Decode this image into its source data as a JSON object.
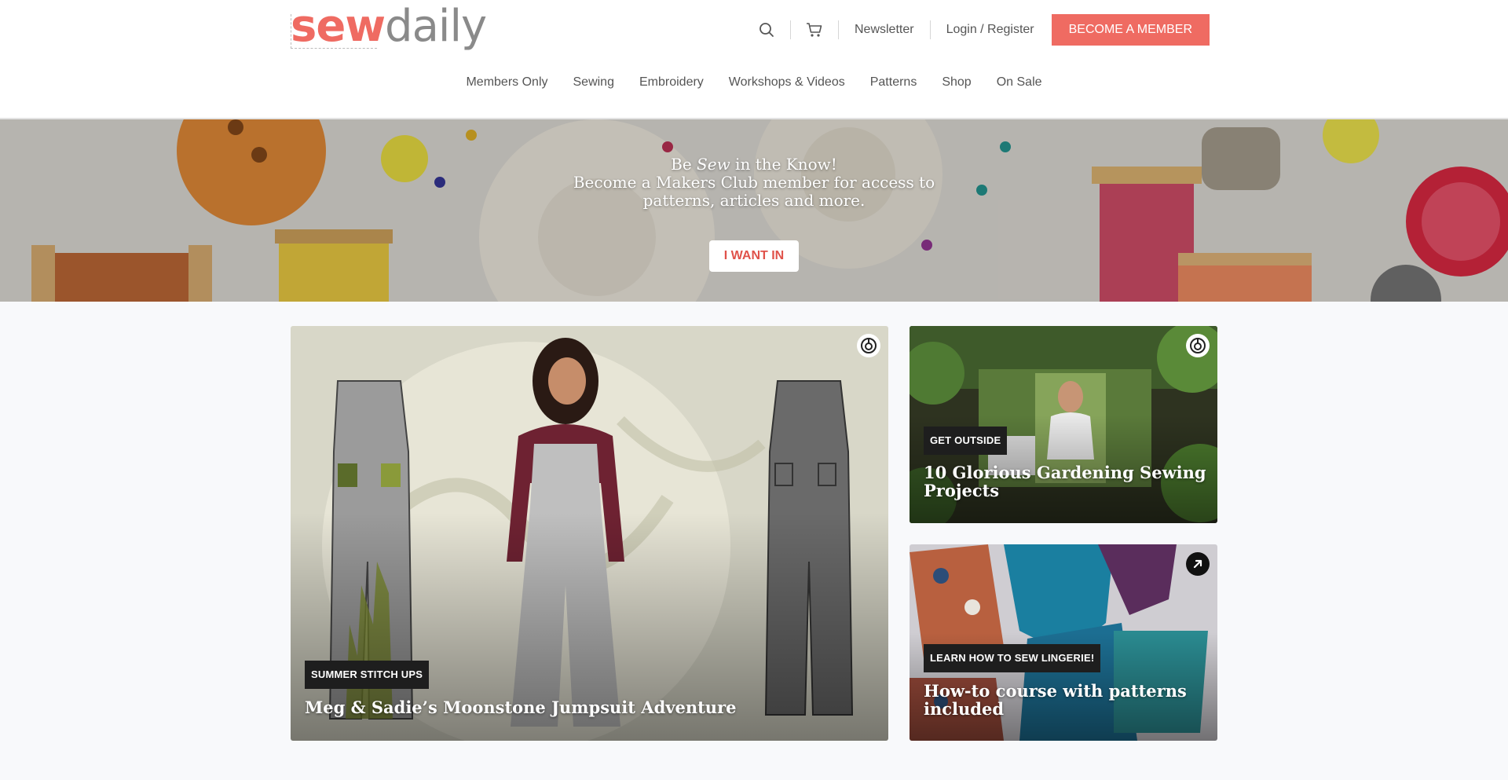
{
  "brand": {
    "logo_sew": "sew",
    "logo_daily": "daily",
    "accent": "#ef6b62"
  },
  "header": {
    "search_icon": "search-icon",
    "cart_icon": "cart-icon",
    "newsletter": "Newsletter",
    "login": "Login / Register",
    "member_button": "BECOME A MEMBER"
  },
  "nav": {
    "items": [
      "Members Only",
      "Sewing",
      "Embroidery",
      "Workshops & Videos",
      "Patterns",
      "Shop",
      "On Sale"
    ]
  },
  "hero": {
    "line1_pre": "Be ",
    "line1_em": "Sew",
    "line1_post": " in the Know!",
    "line2": "Become a Makers Club member for access to",
    "line3": "patterns, articles and more.",
    "cta": "I WANT IN"
  },
  "cards": [
    {
      "badge": "SUMMER STITCH UPS",
      "title": "Meg & Sadie’s Moonstone Jumpsuit Adventure",
      "icon": "members-icon"
    },
    {
      "badge": "GET OUTSIDE",
      "title": "10 Glorious Gardening Sewing Projects",
      "icon": "members-icon"
    },
    {
      "badge": "LEARN HOW TO SEW LINGERIE!",
      "title": "How-to course with patterns included",
      "icon": "external-link-icon"
    }
  ]
}
